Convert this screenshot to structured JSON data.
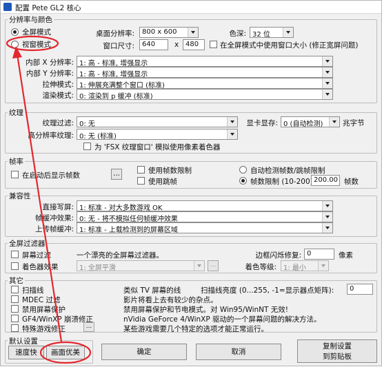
{
  "window": {
    "title": "配置 Pete GL2 核心"
  },
  "res_group": {
    "title": "分辨率与颜色",
    "fullscreen_label": "全屏模式",
    "windowed_label": "视窗模式",
    "desktop_res_label": "桌面分辨率:",
    "desktop_res_value": "800 x 600",
    "color_depth_label": "色深:",
    "color_depth_value": "32 位",
    "window_size_label": "窗口尺寸:",
    "window_w": "640",
    "times": "x",
    "window_h": "480",
    "use_window_size_label": "在全屏模式中使用窗口大小 (修正宽屏问题)",
    "internal_x_label": "内部 X 分辨率:",
    "internal_x_value": "1: 高 - 标准, 增强显示",
    "internal_y_label": "内部 Y 分辨率:",
    "internal_y_value": "1: 高 - 标准, 增强显示",
    "stretch_label": "拉伸模式:",
    "stretch_value": "1: 伸展充满整个窗口 (标准)",
    "render_label": "渲染模式:",
    "render_value": "0: 渲染到 p 缓冲 (标准)"
  },
  "texture_group": {
    "title": "纹理",
    "filter_label": "纹理过滤:",
    "filter_value": "0: 无",
    "hires_label": "高分辨率纹理:",
    "hires_value": "0: 无 (标准)",
    "vram_label": "显卡显存:",
    "vram_value": "0 (自动检测)",
    "vram_unit": "兆字节",
    "fsx_label": "为 'FSX 纹理窗口' 模拟使用像素着色器"
  },
  "fps_group": {
    "title": "帧率",
    "show_fps_label": "在启动后显示帧数",
    "fps_limit_label": "使用帧数限制",
    "frame_skip_label": "使用跳帧",
    "auto_detect_label": "自动检测帧数/跳帧限制",
    "manual_limit_label": "帧数限制 (10-200)",
    "fps_value": "200.00",
    "fps_unit": "帧数",
    "more_button": "..."
  },
  "compat_group": {
    "title": "兼容性",
    "direct_write_label": "直接写屏:",
    "direct_write_value": "1: 标准 - 对大多数游戏 OK",
    "frame_buffer_label": "帧缓冲效果:",
    "frame_buffer_value": "0: 无 - 将不模拟任何帧缓冲效果",
    "upload_label": "上传帧缓冲:",
    "upload_value": "1: 标准 - 上载检测到的屏幕区域"
  },
  "fs_filter_group": {
    "title": "全屏过滤器",
    "shader_label": "屏幕过滤",
    "shader_desc": "一个漂亮的全屏幕过滤器。",
    "scanline_label": "边框闪烁修复:",
    "scanline_value": "0",
    "scanline_unit": "像素",
    "color_effect_label": "着色器效果",
    "color_effect_value": "1: 全屏平滑",
    "color_level_label": "着色等级:",
    "color_level_value": "1: 最小",
    "more_button": "..."
  },
  "misc_group": {
    "title": "其它",
    "items": [
      {
        "label": "扫描线",
        "desc": "类似 TV 屏幕的线"
      },
      {
        "label": "MDEC 过滤",
        "desc": "影片将看上去有较少的杂点。"
      },
      {
        "label": "禁用屏幕保护",
        "desc": "禁用屏幕保护和节电模式。对 Win95/WinNT 无效!"
      },
      {
        "label": "GF4/WinXP 崩溃修正",
        "desc": "nVidia GeForce 4/WinXP 驱动的一个屏幕问题的解决方法。"
      },
      {
        "label": "特殊游戏修正",
        "desc": "某些游戏需要几个特定的选项才能正常运行。"
      }
    ],
    "scan_bright_label": "扫描线亮度 (0...255, -1=显示器点矩阵):",
    "scan_bright_value": "0",
    "more_button": "..."
  },
  "defaults_group": {
    "title": "默认设置",
    "fast_button": "速度快",
    "nice_button": "画面优美"
  },
  "buttons": {
    "ok": "确定",
    "cancel": "取消",
    "copy_line1": "复制设置",
    "copy_line2": "到剪贴板"
  },
  "colors": {
    "annotation": "#e3272d"
  }
}
